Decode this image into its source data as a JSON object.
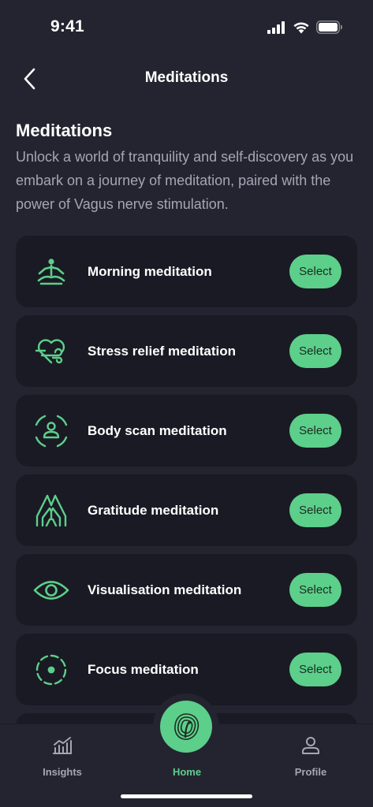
{
  "status_bar": {
    "time": "9:41"
  },
  "nav": {
    "title": "Meditations"
  },
  "header": {
    "title": "Meditations",
    "description": "Unlock a world of tranquility and self-discovery as you embark on a journey of meditation, paired with the power of Vagus nerve stimulation."
  },
  "meditations": [
    {
      "label": "Morning meditation",
      "icon": "lotus-pose-icon",
      "button": "Select"
    },
    {
      "label": "Stress relief meditation",
      "icon": "heart-wind-icon",
      "button": "Select"
    },
    {
      "label": "Body scan meditation",
      "icon": "body-scan-icon",
      "button": "Select"
    },
    {
      "label": "Gratitude meditation",
      "icon": "praying-hands-icon",
      "button": "Select"
    },
    {
      "label": "Visualisation meditation",
      "icon": "eye-icon",
      "button": "Select"
    },
    {
      "label": "Focus meditation",
      "icon": "focus-target-icon",
      "button": "Select"
    }
  ],
  "tab_bar": {
    "insights": "Insights",
    "home": "Home",
    "profile": "Profile"
  },
  "colors": {
    "background": "#242431",
    "card": "#1a1a24",
    "accent": "#5ccf8a",
    "muted_text": "#a4a6b3"
  }
}
